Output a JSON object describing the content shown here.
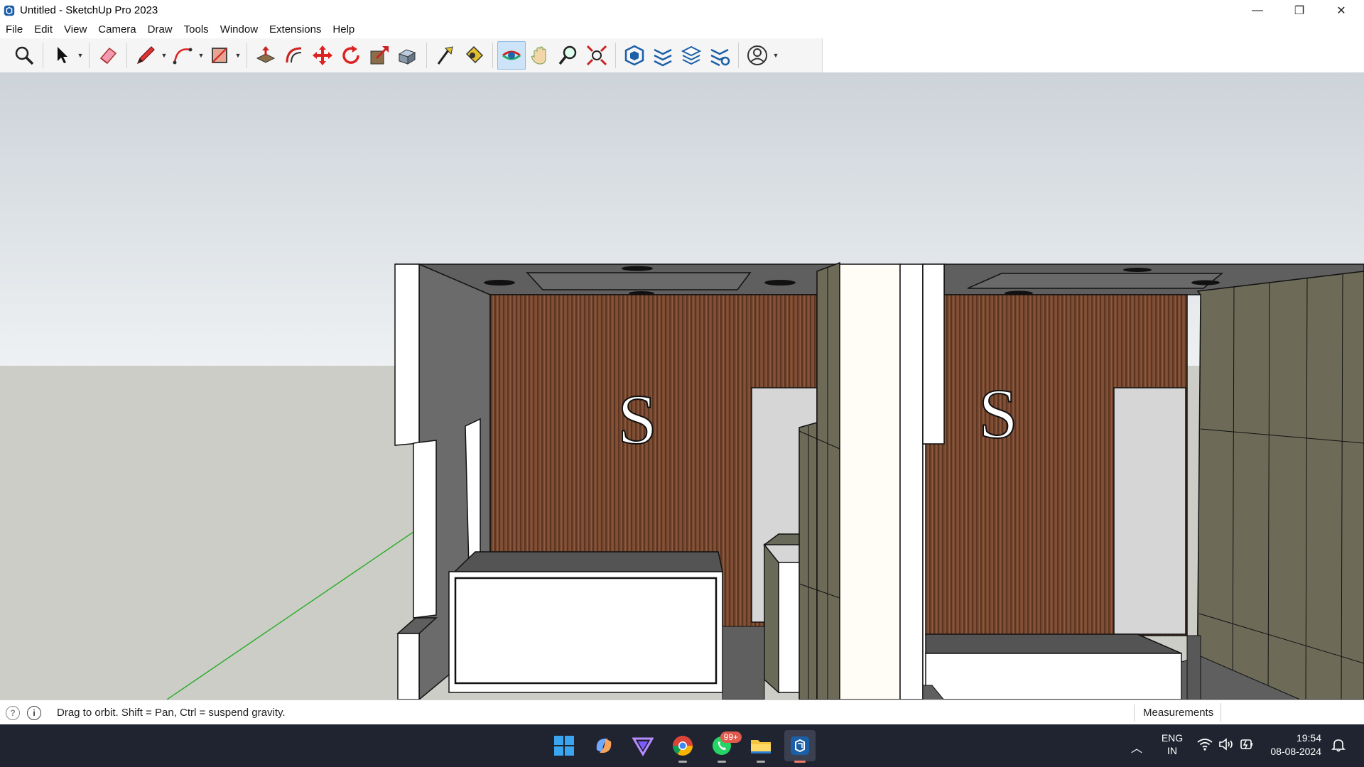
{
  "window": {
    "title": "Untitled - SketchUp Pro 2023",
    "minimize_glyph": "—",
    "maximize_glyph": "❐",
    "close_glyph": "✕"
  },
  "menu": [
    "File",
    "Edit",
    "View",
    "Camera",
    "Draw",
    "Tools",
    "Window",
    "Extensions",
    "Help"
  ],
  "toolbar": {
    "tools": [
      "zoom-extents-icon",
      "select-icon",
      "eraser-icon",
      "pencil-line-icon",
      "arc-icon",
      "rectangle-icon",
      "push-pull-icon",
      "offset-icon",
      "move-icon",
      "rotate-icon",
      "scale-icon",
      "follow-me-icon",
      "tape-measure-icon",
      "paint-bucket-icon",
      "orbit-icon",
      "pan-icon",
      "zoom-icon",
      "zoom-window-icon",
      "components-icon",
      "tags-icon",
      "layers-icon",
      "styles-icon",
      "account-icon"
    ],
    "active_tool": "orbit-icon"
  },
  "viewport": {
    "sign_left": "S",
    "sign_right": "S",
    "colors": {
      "sky_top": "#ccd3d9",
      "sky_bottom": "#e8ecef",
      "ground": "#cdcdc7",
      "wood": "#7a4a31",
      "wall_gray": "#6b6b6b",
      "panel_olive": "#6d6b58"
    }
  },
  "status": {
    "hint": "Drag to orbit. Shift = Pan, Ctrl = suspend gravity.",
    "measurements_label": "Measurements",
    "measurements_value": ""
  },
  "taskbar": {
    "whatsapp_badge": "99+",
    "lang_top": "ENG",
    "lang_bottom": "IN",
    "time": "19:54",
    "date": "08-08-2024"
  }
}
